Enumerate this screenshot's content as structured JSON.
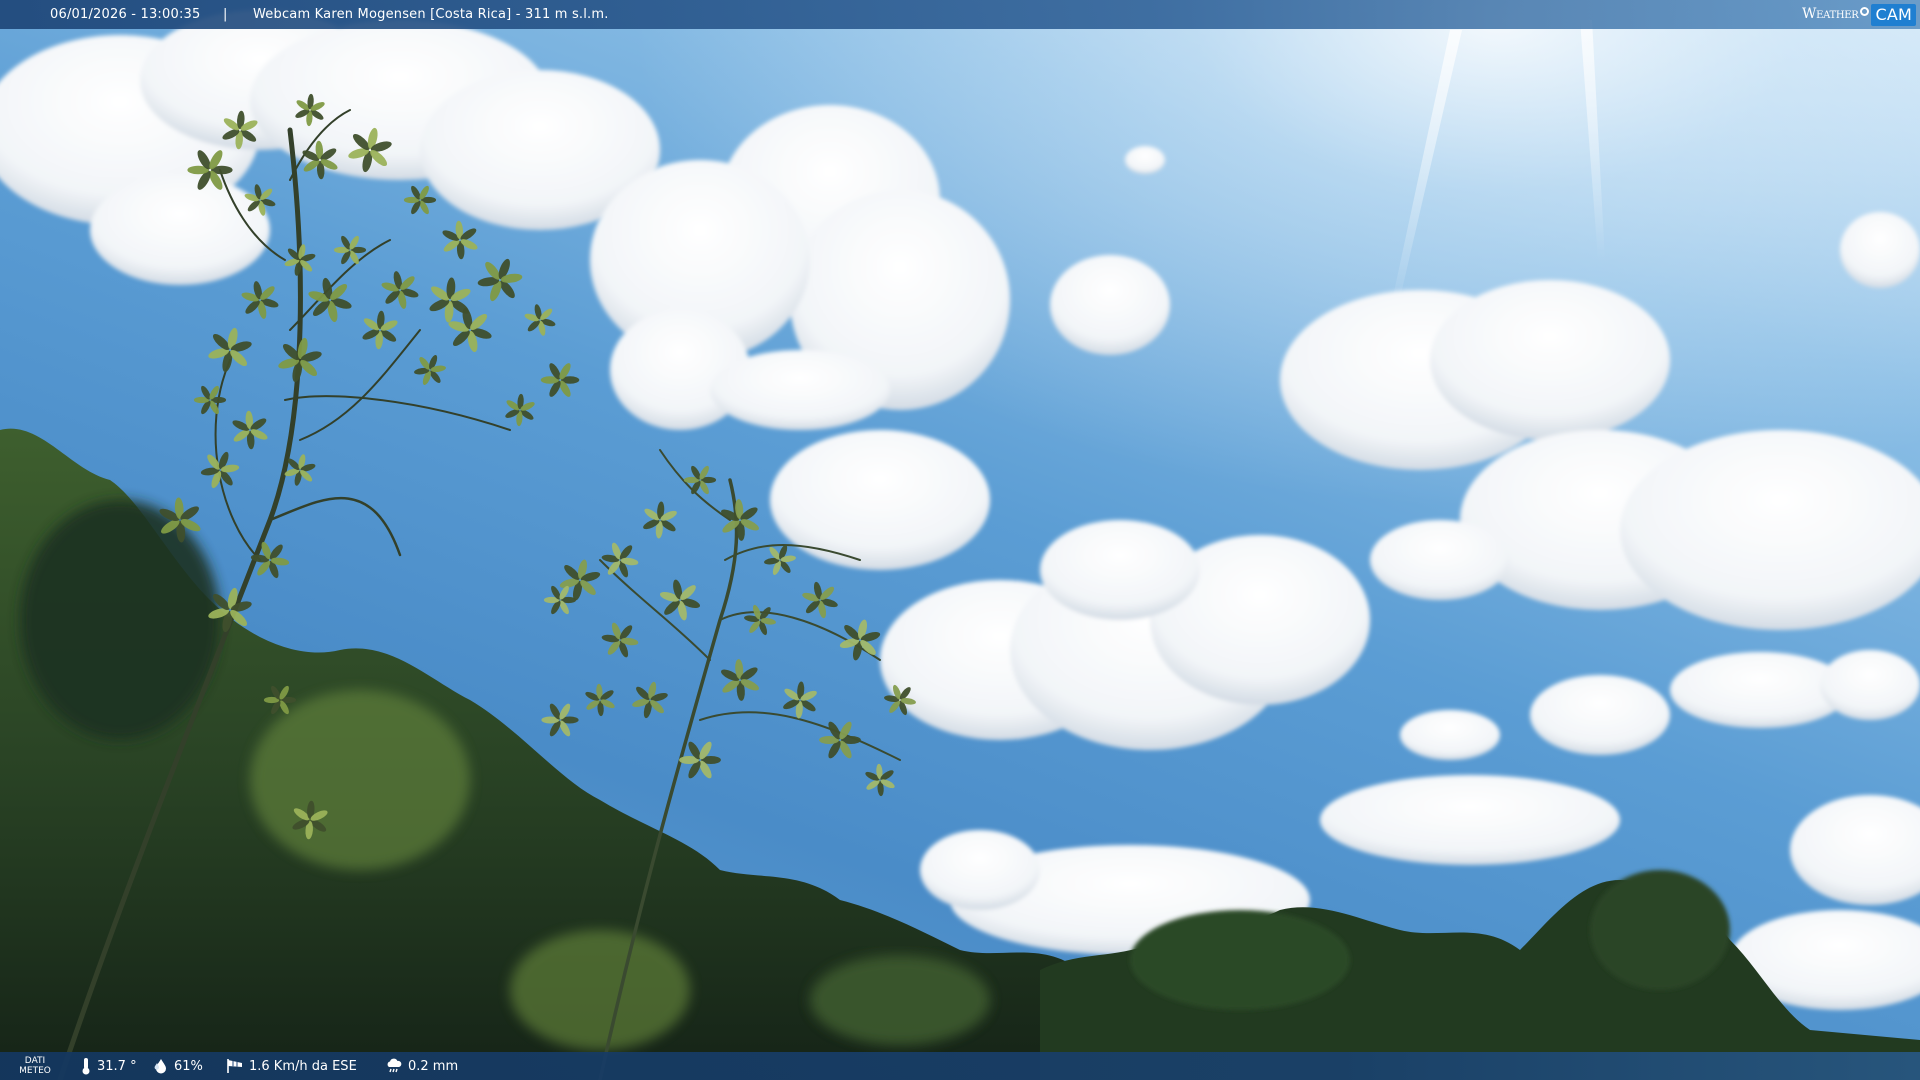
{
  "header": {
    "timestamp": "06/01/2026 - 13:00:35",
    "separator": "|",
    "title": "Webcam Karen Mogensen [Costa Rica]  - 311 m s.l.m.",
    "brand_weather": "Weather",
    "brand_cam": "CAM"
  },
  "meteo": {
    "label_line1": "DATI",
    "label_line2": "METEO",
    "temperature": "31.7 °",
    "humidity": "61%",
    "wind": "1.6 Km/h da ESE",
    "rain": "0.2 mm"
  },
  "colors": {
    "sky_top": "#cfe6f7",
    "sky_mid": "#5b9dd4",
    "bar": "#1e4678",
    "brand_accent": "#1f7fd1",
    "foliage_dark": "#1f3a22",
    "foliage_light": "#6f8f45"
  },
  "icons": {
    "temperature": "thermometer-icon",
    "humidity": "droplet-icon",
    "wind": "wind-sock-icon",
    "rain": "rain-cloud-icon"
  }
}
